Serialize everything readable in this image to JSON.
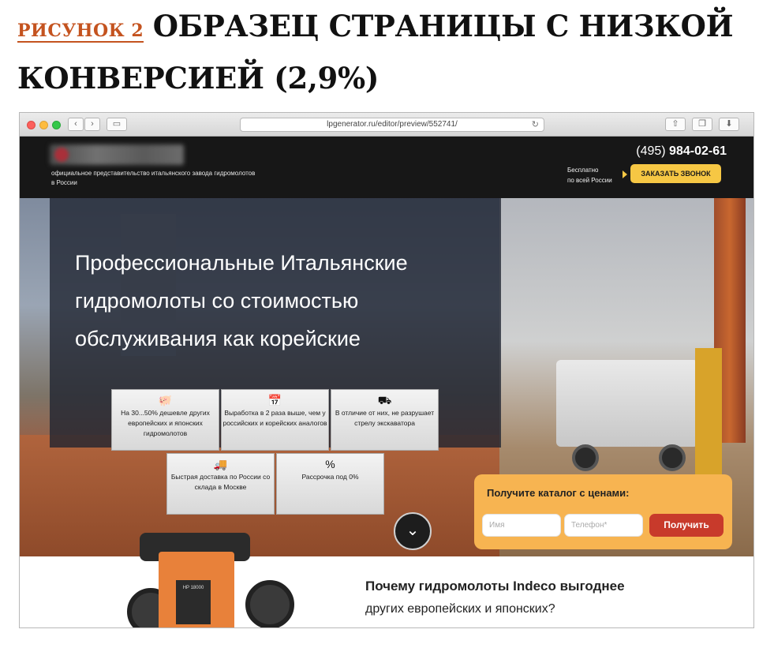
{
  "caption": {
    "figure_label": "РИСУНОК 2",
    "title": "ОБРАЗЕЦ СТРАНИЦЫ С НИЗКОЙ КОНВЕРСИЕЙ (2,9%)"
  },
  "browser": {
    "url": "lpgenerator.ru/editor/preview/552741/"
  },
  "header": {
    "tagline": "официальное представительство итальянского завода гидромолотов в России",
    "phone_code": "(495)",
    "phone_number": "984-02-61",
    "free_line1": "Бесплатно",
    "free_line2": "по всей России",
    "call_button": "ЗАКАЗАТЬ ЗВОНОК"
  },
  "hero": {
    "heading": "Профессиональные Итальянские гидромолоты со стоимостью обслуживания как корейские",
    "features": [
      {
        "icon": "piggy-bank-icon",
        "glyph": "🐖",
        "text": "На 30...50% дешевле других европейских и японских гидромолотов"
      },
      {
        "icon": "calendar-clock-icon",
        "glyph": "📅",
        "text": "Выработка в 2 раза выше, чем у российских и корейских аналогов"
      },
      {
        "icon": "excavator-tracks-icon",
        "glyph": "⛟",
        "text": "В отличие от них, не разрушает стрелу экскаватора"
      },
      {
        "icon": "delivery-truck-icon",
        "glyph": "🚚",
        "text": "Быстрая доставка по России со склада в Москве"
      },
      {
        "icon": "percent-icon",
        "glyph": "%",
        "text": "Рассрочка под 0%"
      }
    ],
    "scroll_icon": "chevron-down-icon"
  },
  "catalog_form": {
    "title": "Получите каталог с ценами:",
    "name_placeholder": "Имя",
    "phone_placeholder": "Телефон*",
    "submit": "Получить"
  },
  "section": {
    "heading_line1": "Почему гидромолоты Indeco выгоднее",
    "heading_line2": "других европейских и японских?",
    "product_label": "HP 18000"
  }
}
